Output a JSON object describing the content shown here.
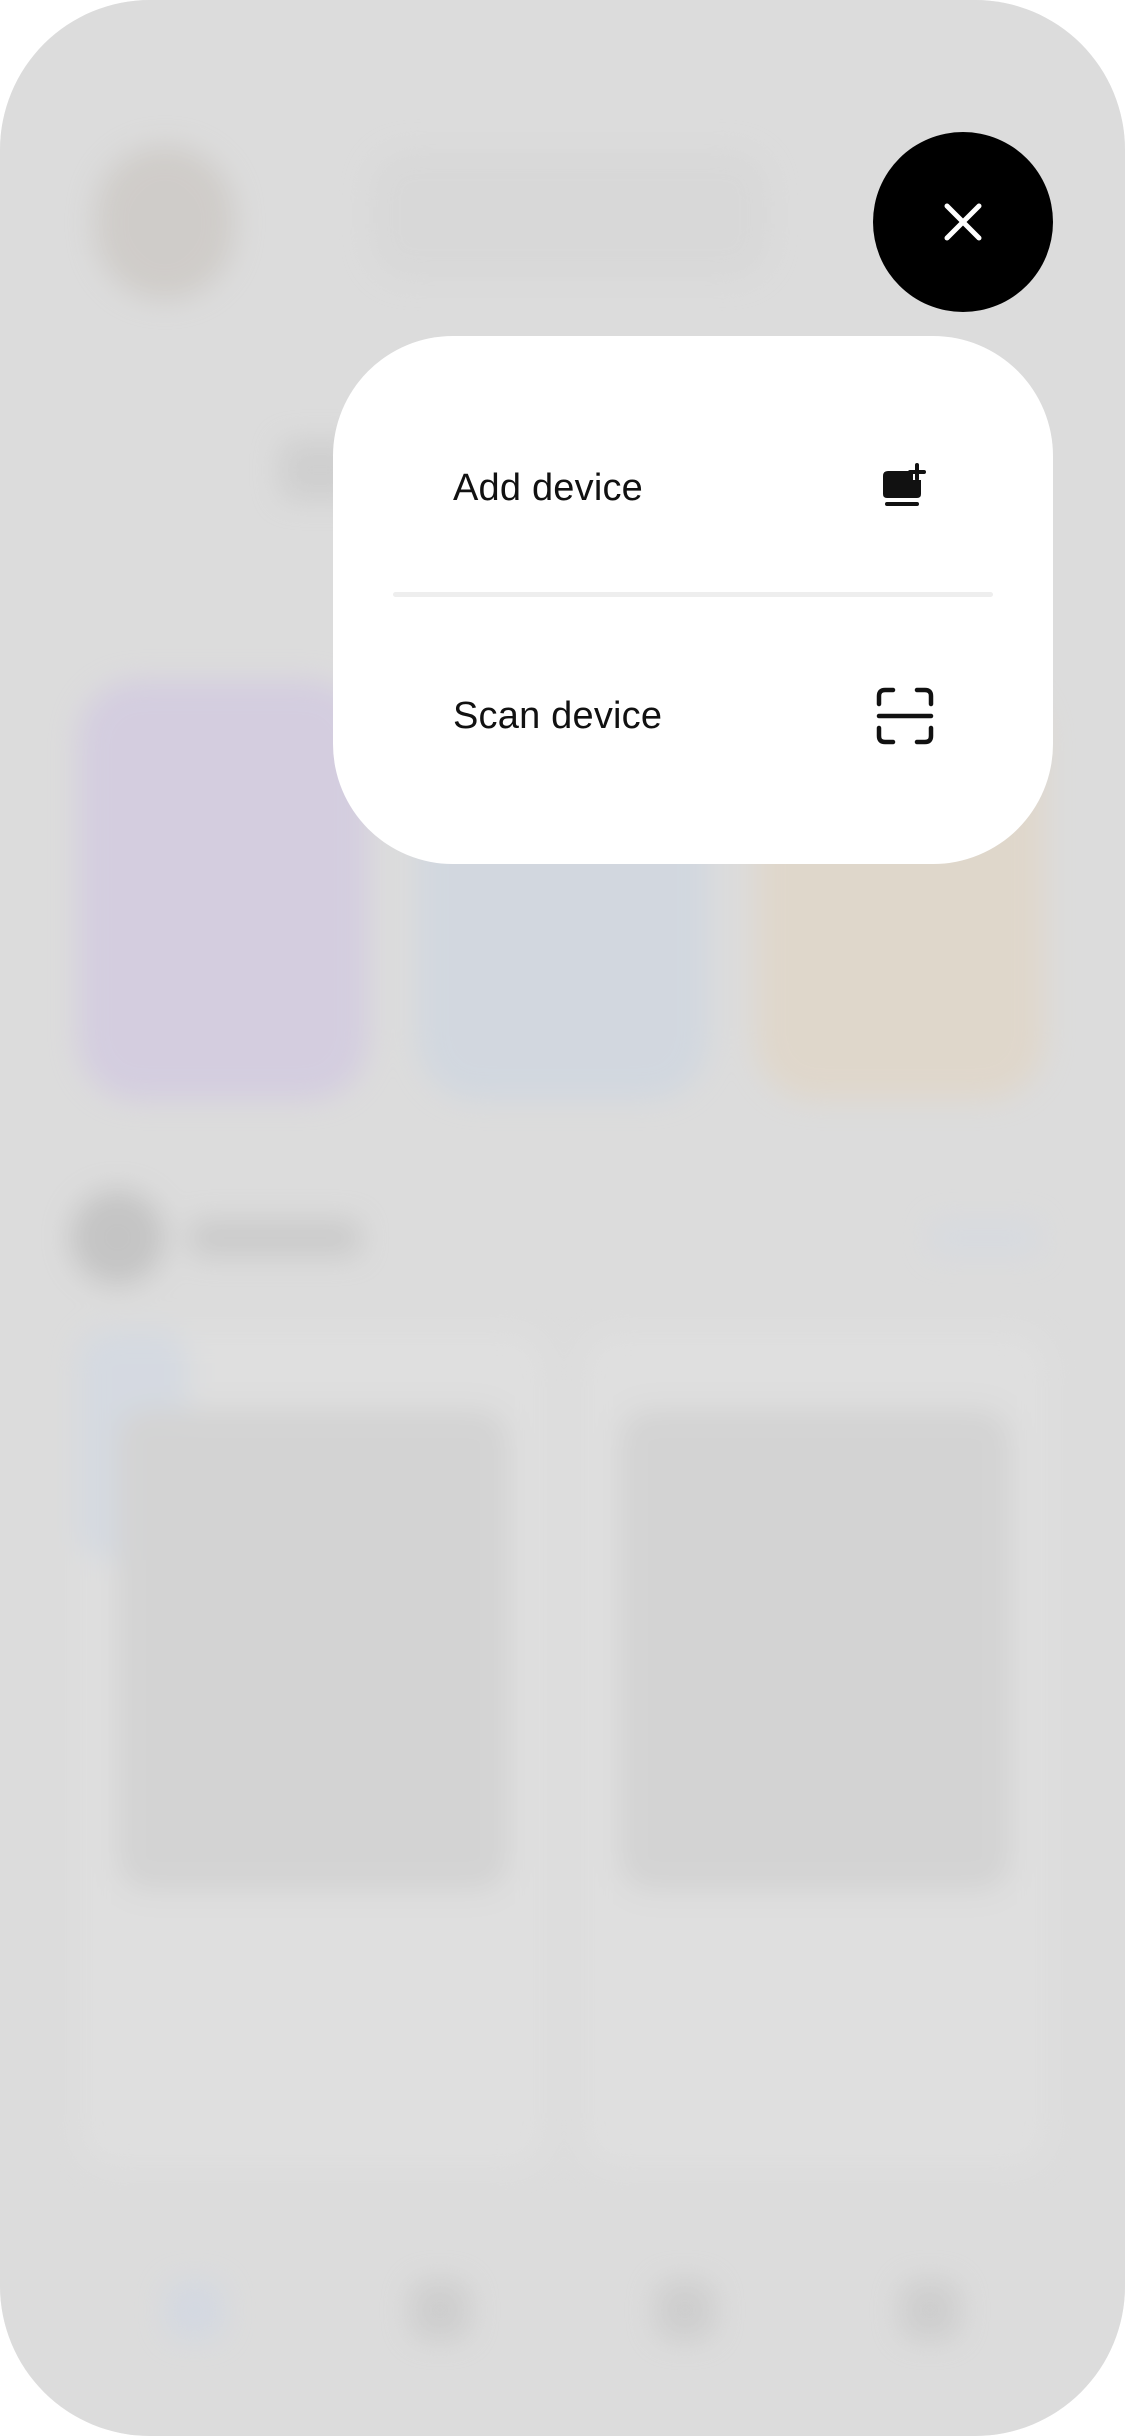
{
  "menu": {
    "items": [
      {
        "label": "Add device",
        "icon": "add-device-icon"
      },
      {
        "label": "Scan device",
        "icon": "scan-icon"
      }
    ]
  },
  "close_button": {
    "icon": "close-icon"
  },
  "colors": {
    "overlay": "#dcdcdc",
    "menu_background": "#ffffff",
    "close_button": "#000000",
    "text": "#111111"
  }
}
